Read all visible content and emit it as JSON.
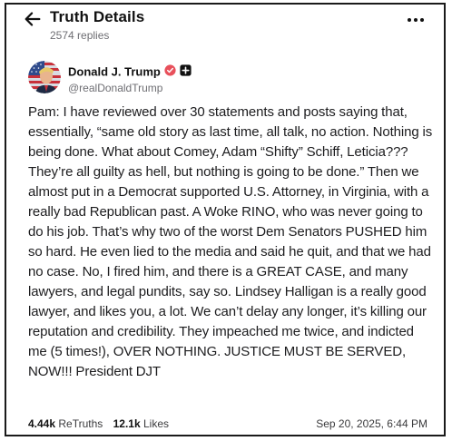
{
  "header": {
    "title": "Truth Details",
    "replies": "2574 replies",
    "back_icon": "arrow-left-icon",
    "more_icon": "more-horizontal-icon"
  },
  "author": {
    "name": "Donald J. Trump",
    "handle": "@realDonaldTrump",
    "avatar_icon": "profile-avatar",
    "verified_icon": "verified-badge-icon",
    "verified_color": "#e8505b",
    "follow_icon": "follow-plus-icon"
  },
  "post": {
    "text": "Pam: I have reviewed over 30 statements and posts saying that, essentially, “same old story as last time, all talk, no action. Nothing is being done. What about Comey, Adam “Shifty” Schiff, Leticia??? They’re all guilty as hell, but nothing is going to be done.” Then we almost put in a Democrat supported U.S. Attorney, in Virginia, with a really bad Republican past. A Woke RINO, who was never going to do his job. That’s why two of the worst Dem Senators PUSHED him so hard. He even lied to the media and said he quit, and that we had no case. No, I fired him, and there is a GREAT CASE, and many lawyers, and legal pundits, say so. Lindsey Halligan is a really good lawyer, and likes you, a lot. We can’t delay any longer, it’s killing our reputation and credibility. They impeached me twice, and indicted me (5 times!), OVER NOTHING. JUSTICE MUST BE SERVED, NOW!!! President DJT"
  },
  "stats": {
    "retruths_count": "4.44k",
    "retruths_label": "ReTruths",
    "likes_count": "12.1k",
    "likes_label": "Likes",
    "timestamp": "Sep 20, 2025, 6:44 PM"
  }
}
